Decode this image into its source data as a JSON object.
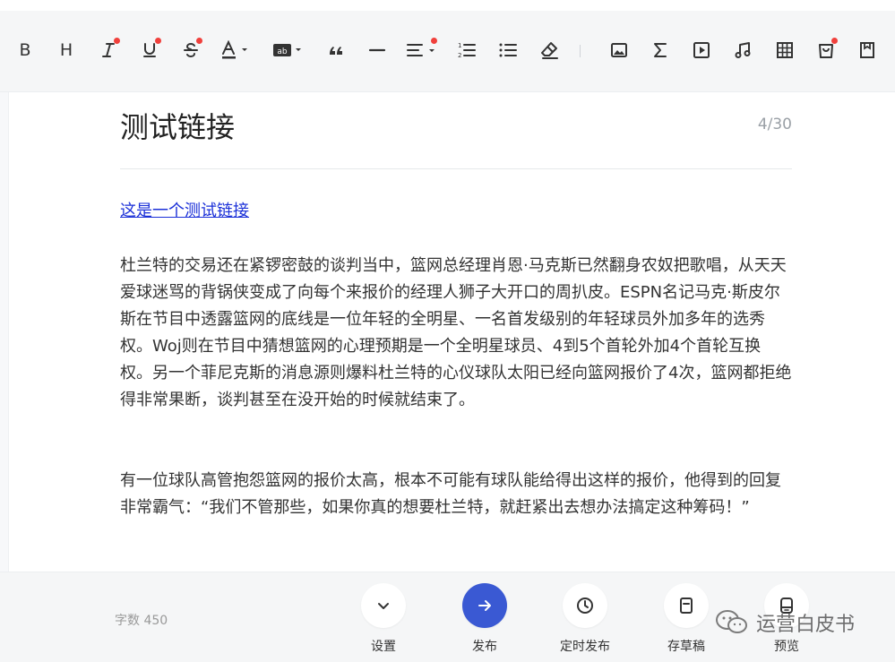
{
  "toolbar": {
    "bold_label": "B",
    "heading_label": "H"
  },
  "editor": {
    "title": "测试链接",
    "title_count": "4/30",
    "link_text": "这是一个测试链接",
    "paragraphs": [
      "杜兰特的交易还在紧锣密鼓的谈判当中，篮网总经理肖恩·马克斯已然翻身农奴把歌唱，从天天爱球迷骂的背锅侠变成了向每个来报价的经理人狮子大开口的周扒皮。ESPN名记马克·斯皮尔斯在节目中透露篮网的底线是一位年轻的全明星、一名首发级别的年轻球员外加多年的选秀权。Woj则在节目中猜想篮网的心理预期是一个全明星球员、4到5个首轮外加4个首轮互换权。另一个菲尼克斯的消息源则爆料杜兰特的心仪球队太阳已经向篮网报价了4次，篮网都拒绝得非常果断，谈判甚至在没开始的时候就结束了。",
      "有一位球队高管抱怨篮网的报价太高，根本不可能有球队能给得出这样的报价，他得到的回复非常霸气：“我们不管那些，如果你真的想要杜兰特，就赶紧出去想办法搞定这种筹码！”"
    ]
  },
  "footer": {
    "word_count": "字数 450",
    "actions": {
      "settings": "设置",
      "publish": "发布",
      "schedule": "定时发布",
      "save_draft": "存草稿",
      "preview": "预览"
    },
    "watermark": "运营白皮书"
  },
  "colors": {
    "primary": "#3a59d3",
    "link": "#1a2fd8",
    "badge": "#f0403c"
  }
}
